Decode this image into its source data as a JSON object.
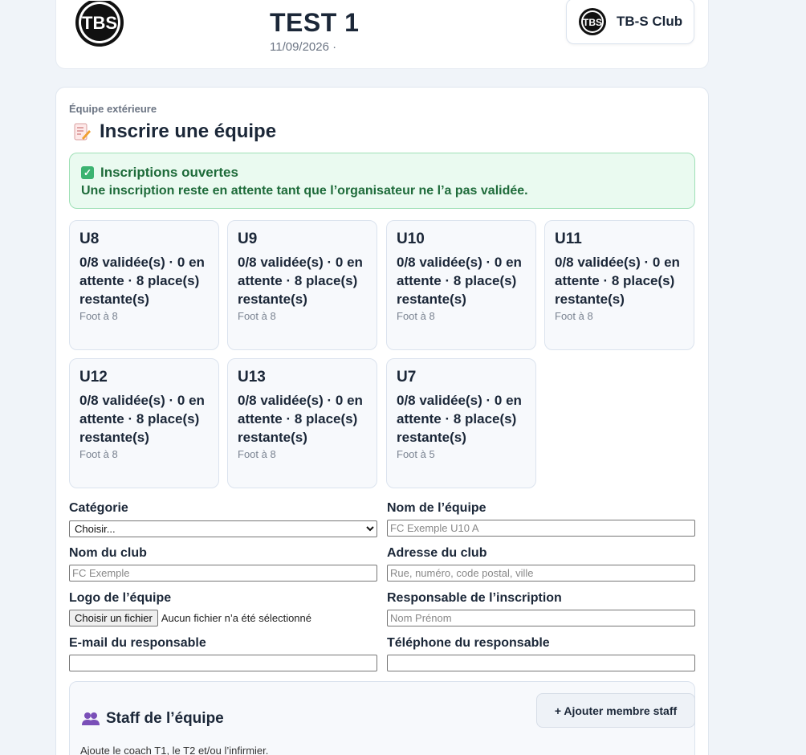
{
  "header": {
    "event_title": "TEST 1",
    "event_date": "11/09/2026 ·",
    "club_name": "TB-S Club",
    "logo_text": "TBS",
    "badge_logo_text": "TBS"
  },
  "section": {
    "eyebrow": "Équipe extérieure",
    "title": "Inscrire une équipe",
    "title_icon": "memo-icon"
  },
  "alert": {
    "title": "Inscriptions ouvertes",
    "text": "Une inscription reste en attente tant que l’organisateur ne l’a pas validée.",
    "icon": "check-icon",
    "color": "#1e6b3a"
  },
  "categories": [
    {
      "name": "U8",
      "stats": "0/8 validée(s) · 0 en attente · 8 place(s) restante(s)",
      "format": "Foot à 8"
    },
    {
      "name": "U9",
      "stats": "0/8 validée(s) · 0 en attente · 8 place(s) restante(s)",
      "format": "Foot à 8"
    },
    {
      "name": "U10",
      "stats": "0/8 validée(s) · 0 en attente · 8 place(s) restante(s)",
      "format": "Foot à 8"
    },
    {
      "name": "U11",
      "stats": "0/8 validée(s) · 0 en attente · 8 place(s) restante(s)",
      "format": "Foot à 8"
    },
    {
      "name": "U12",
      "stats": "0/8 validée(s) · 0 en attente · 8 place(s) restante(s)",
      "format": "Foot à 8"
    },
    {
      "name": "U13",
      "stats": "0/8 validée(s) · 0 en attente · 8 place(s) restante(s)",
      "format": "Foot à 8"
    },
    {
      "name": "U7",
      "stats": "0/8 validée(s) · 0 en attente · 8 place(s) restante(s)",
      "format": "Foot à 5"
    }
  ],
  "form": {
    "category_label": "Catégorie",
    "category_value": "Choisir...",
    "team_name_label": "Nom de l’équipe",
    "team_name_placeholder": "FC Exemple U10 A",
    "club_name_label": "Nom du club",
    "club_name_placeholder": "FC Exemple",
    "club_address_label": "Adresse du club",
    "club_address_placeholder": "Rue, numéro, code postal, ville",
    "logo_label": "Logo de l’équipe",
    "file_button": "Choisir un fichier",
    "file_status": "Aucun fichier n’a été sélectionné",
    "manager_label": "Responsable de l’inscription",
    "manager_placeholder": "Nom Prénom",
    "email_label": "E-mail du responsable",
    "phone_label": "Téléphone du responsable"
  },
  "staff": {
    "title": "Staff de l’équipe",
    "icon": "people-icon",
    "add_button": "+ Ajouter membre staff",
    "help": "Ajoute le coach T1, le T2 et/ou l’infirmier."
  }
}
